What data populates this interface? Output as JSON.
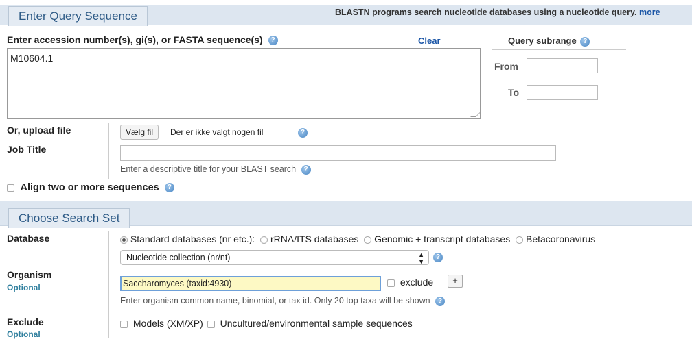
{
  "query_section": {
    "tab": "Enter Query Sequence",
    "header_info": "BLASTN programs search nucleotide databases using a nucleotide query.",
    "header_more": "more",
    "seq_label": "Enter accession number(s), gi(s), or FASTA sequence(s)",
    "clear": "Clear",
    "seq_value": "M10604.1",
    "subrange_title": "Query subrange",
    "from_label": "From",
    "to_label": "To",
    "upload_label": "Or, upload file",
    "choose_file_button": "Vælg fil",
    "no_file_text": "Der er ikke valgt nogen fil",
    "job_title_label": "Job Title",
    "job_title_hint": "Enter a descriptive title for your BLAST search",
    "align_label": "Align two or more sequences"
  },
  "search_set": {
    "tab": "Choose Search Set",
    "database_label": "Database",
    "database_options": [
      "Standard databases (nr etc.):",
      "rRNA/ITS databases",
      "Genomic + transcript databases",
      "Betacoronavirus"
    ],
    "database_selected": "Nucleotide collection (nr/nt)",
    "organism_label": "Organism",
    "optional": "Optional",
    "organism_value": "Saccharomyces (taxid:4930)",
    "exclude_checkbox": "exclude",
    "add_button": "+",
    "organism_hint": "Enter organism common name, binomial, or tax id. Only 20 top taxa will be shown",
    "exclude_label": "Exclude",
    "exclude_options": [
      "Models (XM/XP)",
      "Uncultured/environmental sample sequences"
    ]
  },
  "icons": {
    "help": "help-icon",
    "select_arrows": "updown-arrow-icon"
  }
}
